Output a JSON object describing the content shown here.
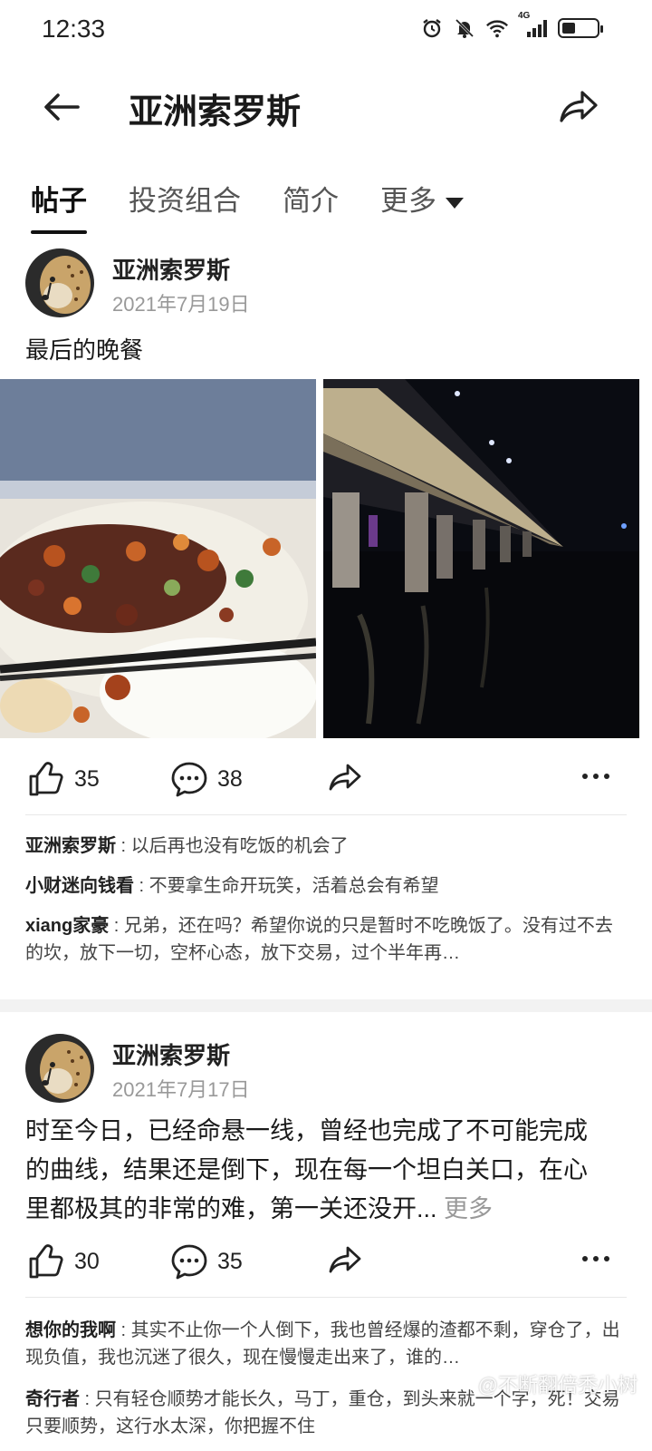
{
  "status_bar": {
    "time": "12:33",
    "network": "4G"
  },
  "header": {
    "title": "亚洲索罗斯"
  },
  "tabs": [
    {
      "label": "帖子"
    },
    {
      "label": "投资组合"
    },
    {
      "label": "简介"
    },
    {
      "label": "更多"
    }
  ],
  "posts": [
    {
      "author": "亚洲索罗斯",
      "date": "2021年7月19日",
      "text": "最后的晚餐",
      "likes": "35",
      "comments_count": "38",
      "comments": [
        {
          "name": "亚洲索罗斯",
          "text": "以后再也没有吃饭的机会了"
        },
        {
          "name": "小财迷向钱看",
          "text": "不要拿生命开玩笑，活着总会有希望"
        },
        {
          "name": "xiang家豪",
          "text": "兄弟，还在吗？希望你说的只是暂时不吃晚饭了。没有过不去的坎，放下一切，空杯心态，放下交易，过个半年再…"
        }
      ]
    },
    {
      "author": "亚洲索罗斯",
      "date": "2021年7月17日",
      "text": "时至今日，已经命悬一线，曾经也完成了不可能完成的曲线，结果还是倒下，现在每一个坦白关口，在心里都极其的非常的难，第一关还没开...",
      "more": "更多",
      "likes": "30",
      "comments_count": "35",
      "comments": [
        {
          "name": "想你的我啊",
          "text": "其实不止你一个人倒下，我也曾经爆的渣都不剩，穿仓了，出现负值，我也沉迷了很久，现在慢慢走出来了，谁的…"
        },
        {
          "name": "奇行者",
          "text": "只有轻仓顺势才能长久，马丁，重仓，到头来就一个字，死！交易只要顺势，这行水太深，你把握不住"
        }
      ]
    }
  ],
  "watermark": "@不断翻倍秃小树",
  "colors": {
    "accent": "#111111",
    "muted": "#999999",
    "gap": "#f2f2f2"
  }
}
